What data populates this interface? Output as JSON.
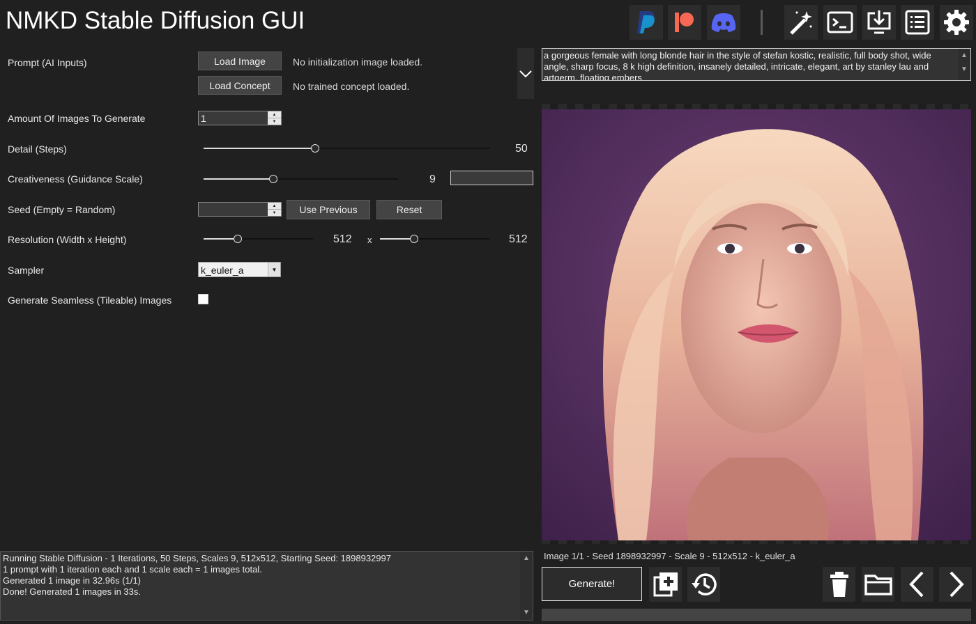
{
  "app": {
    "title": "NMKD Stable Diffusion GUI"
  },
  "toolbar": {
    "icons": [
      "paypal-icon",
      "patreon-icon",
      "discord-icon",
      "magic-wand-icon",
      "terminal-icon",
      "install-icon",
      "log-list-icon",
      "settings-gear-icon"
    ],
    "colors": {
      "paypal_dark": "#253b80",
      "paypal_light": "#179bd7",
      "patreon": "#f96854",
      "discord": "#5865f2"
    }
  },
  "prompt_section": {
    "label": "Prompt (AI Inputs)",
    "load_image_label": "Load Image",
    "init_image_status": "No initialization image loaded.",
    "load_concept_label": "Load Concept",
    "concept_status": "No trained concept loaded.",
    "prompt_text": "a gorgeous female with long blonde hair in the style of stefan kostic, realistic, full body shot, wide angle, sharp focus, 8 k high definition, insanely detailed, intricate, elegant, art by stanley lau and artgerm, floating embers"
  },
  "settings": {
    "amount": {
      "label": "Amount Of Images To Generate",
      "value": "1"
    },
    "steps": {
      "label": "Detail (Steps)",
      "value": "50",
      "level_fraction": 0.39
    },
    "guidance": {
      "label": "Creativeness (Guidance Scale)",
      "value": "9",
      "text_value": "",
      "level_fraction": 0.36
    },
    "seed": {
      "label": "Seed (Empty = Random)",
      "value": "",
      "use_previous_label": "Use Previous",
      "reset_label": "Reset"
    },
    "resolution": {
      "label": "Resolution (Width x Height)",
      "width": "512",
      "separator": "x",
      "height": "512",
      "width_fraction": 0.31,
      "height_fraction": 0.31
    },
    "sampler": {
      "label": "Sampler",
      "value": "k_euler_a"
    },
    "seamless": {
      "label": "Generate Seamless (Tileable) Images",
      "checked": false
    }
  },
  "log": {
    "lines": [
      "Running Stable Diffusion - 1 Iterations, 50 Steps, Scales 9, 512x512, Starting Seed: 1898932997",
      "1 prompt with 1 iteration each and 1 scale each = 1 images total.",
      "Generated 1 image in 32.96s (1/1)",
      "Done! Generated 1 images in 33s."
    ]
  },
  "output": {
    "image_info": "Image 1/1  - Seed 1898932997 - Scale 9 - 512x512 - k_euler_a",
    "generate_label": "Generate!",
    "action_icons": [
      "add-to-queue-icon",
      "history-icon",
      "delete-icon",
      "open-folder-icon",
      "previous-image-icon",
      "next-image-icon"
    ]
  }
}
